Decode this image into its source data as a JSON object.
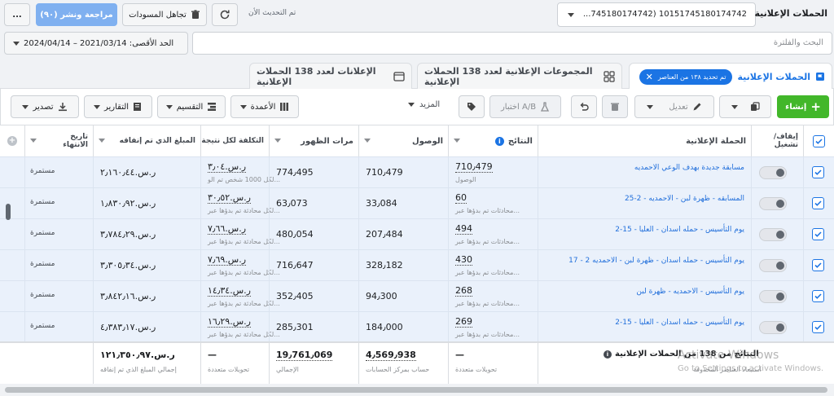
{
  "topbar": {
    "page_title": "الحملات الإعلانية",
    "account_value": "...745180174742) 10151745180174742",
    "last_updated": "تم التحديث الأن",
    "discard_drafts": "تجاهل المسودات",
    "review_publish": "مراجعة ونشر (٩٠)",
    "more": "..."
  },
  "search": {
    "placeholder": "البحث والفلترة",
    "date_range": "2024/04/14 – 2021/03/14 :الحد الأقصى"
  },
  "tabs": {
    "campaigns": "الحملات الإعلانية",
    "selected_chip": "تم تحديد ١٣٨ من العناصر",
    "adsets": "المجموعات الإعلانية لعدد 138 الحملات الإعلانية",
    "ads": "الإعلانات لعدد 138 الحملات الإعلانية"
  },
  "toolbar": {
    "create": "إنشاء",
    "edit": "تعديل",
    "ab_test": "اختبار A/B",
    "more": "المزيد",
    "columns": "الأعمدة",
    "breakdown": "التقسيم",
    "reports": "التقارير",
    "export": "تصدير"
  },
  "columns": {
    "toggle": "إيقاف/ تشغيل",
    "campaign": "الحملة الإعلانية",
    "results": "النتائج",
    "reach": "الوصول",
    "impressions": "مرات الظهور",
    "cost_per_result": "التكلفة لكل نتيجة",
    "amount_spent": "المبلغ الذي تم إنفاقه",
    "end_date": "تاريخ الانتهاء"
  },
  "rows": [
    {
      "name": "مسابقة جديدة بهدف الوعي الاحمديه",
      "results": "710٫479",
      "results_sub": "الوصول",
      "reach": "710٫479",
      "impressions": "774٫495",
      "cost": "ر.س.٣٫٠٤",
      "cost_sub": "لكل 1000 شخص تم الو...",
      "spent": "ر.س.٢٫١٦٠٫٤٤",
      "end": "مستمرة"
    },
    {
      "name": "المسابقه - ظهرة لبن - الاحمديه - 2-25",
      "results": "60",
      "results_sub": "محادثات تم بدؤها عبر...",
      "reach": "33٫084",
      "impressions": "63٫073",
      "cost": "ر.س.٣٠٫٥٢",
      "cost_sub": "لكل محادثة تم بدؤها عبر...",
      "spent": "ر.س.١٫٨٣٠٫٩٢",
      "end": "مستمرة"
    },
    {
      "name": "يوم التأسيس - حمله اسدان - العليا - 15-2",
      "results": "494",
      "results_sub": "محادثات تم بدؤها عبر...",
      "reach": "207٫484",
      "impressions": "480٫054",
      "cost": "ر.س.٧٫٦٦",
      "cost_sub": "لكل محادثة تم بدؤها عبر...",
      "spent": "ر.س.٣٫٧٨٤٫٢٩",
      "end": "مستمرة"
    },
    {
      "name": "17 - 2 يوم التأسيس - حمله اسدان - ظهرة لبن - الاحمديه",
      "results": "430",
      "results_sub": "محادثات تم بدؤها عبر...",
      "reach": "328٫182",
      "impressions": "716٫647",
      "cost": "ر.س.٧٫٦٩",
      "cost_sub": "لكل محادثة تم بدؤها عبر...",
      "spent": "ر.س.٣٫٣٠٥٫٣٤",
      "end": "مستمرة"
    },
    {
      "name": "يوم التأسيس - الاحمديه - ظهرة لبن",
      "results": "268",
      "results_sub": "محادثات تم بدؤها عبر...",
      "reach": "94٫300",
      "impressions": "352٫405",
      "cost": "ر.س.١٤٫٣٤",
      "cost_sub": "لكل محادثة تم بدؤها عبر...",
      "spent": "ر.س.٣٫٨٤٢٫١٦",
      "end": "مستمرة"
    },
    {
      "name": "يوم التأسيس - حمله اسدان - العليا - 15-2",
      "results": "269",
      "results_sub": "محادثات تم بدؤها عبر...",
      "reach": "184٫000",
      "impressions": "285٫301",
      "cost": "ر.س.١٦٫٢٩",
      "cost_sub": "لكل محادثة تم بدؤها عبر...",
      "spent": "ر.س.٤٫٣٨٣٫١٧",
      "end": "مستمرة"
    }
  ],
  "footer": {
    "title": "النتائج من 138 من الحملات الإعلانية",
    "title_sub": "استبعاد العناصر المحذوفة",
    "results": "—",
    "results_sub": "تحويلات متعددة",
    "reach": "4٫569٫938",
    "reach_sub": "حساب بمركز الحسابات",
    "impressions": "19٫761٫069",
    "impressions_sub": "الإجمالي",
    "cost": "—",
    "cost_sub": "تحويلات متعددة",
    "spent": "ر.س.١٢١٫٣٥٠٫٩٧",
    "spent_sub": "إجمالي المبلغ الذي تم إنفاقه"
  },
  "watermark": {
    "line1": "Activate Windows",
    "line2": "Go to Settings to activate Windows."
  },
  "colors": {
    "accent": "#1b74e4",
    "create_green": "#42b72a",
    "row_selected": "#eaf1fb",
    "link": "#216fdb"
  }
}
